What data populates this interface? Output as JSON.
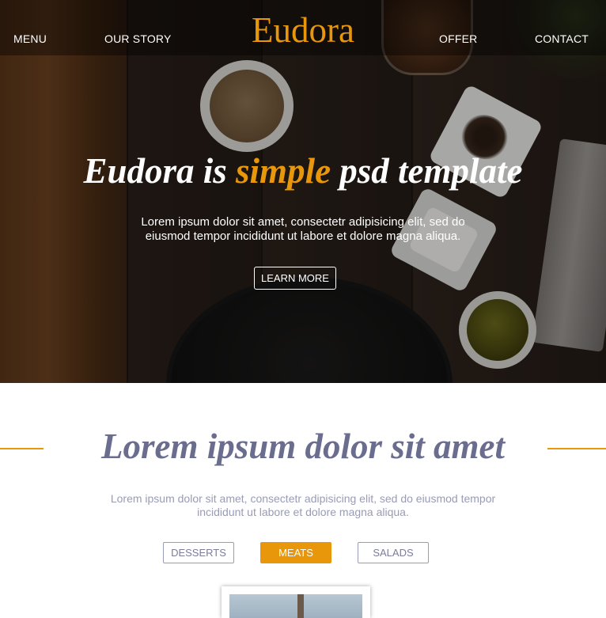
{
  "nav": {
    "left_items": [
      "MENU",
      "OUR STORY"
    ],
    "logo": "Eudora",
    "right_items": [
      "OFFER",
      "CONTACT"
    ]
  },
  "hero": {
    "title_part1": "Eudora is ",
    "title_accent": "simple",
    "title_part2": " psd template",
    "subtitle": "Lorem ipsum dolor sit amet, consectetr adipisicing elit, sed do eiusmod tempor incididunt ut labore et dolore magna aliqua.",
    "button_label": "LEARN MORE"
  },
  "section": {
    "title": "Lorem ipsum dolor sit amet",
    "subtitle": "Lorem ipsum dolor sit amet, consectetr adipisicing elit, sed do eiusmod tempor incididunt ut labore et dolore magna aliqua."
  },
  "filters": [
    {
      "label": "DESSERTS",
      "active": false
    },
    {
      "label": "MEATS",
      "active": true
    },
    {
      "label": "SALADS",
      "active": false
    }
  ],
  "colors": {
    "accent": "#e8960a",
    "heading": "#6b6d8f",
    "muted_text": "#9a9bb5"
  }
}
